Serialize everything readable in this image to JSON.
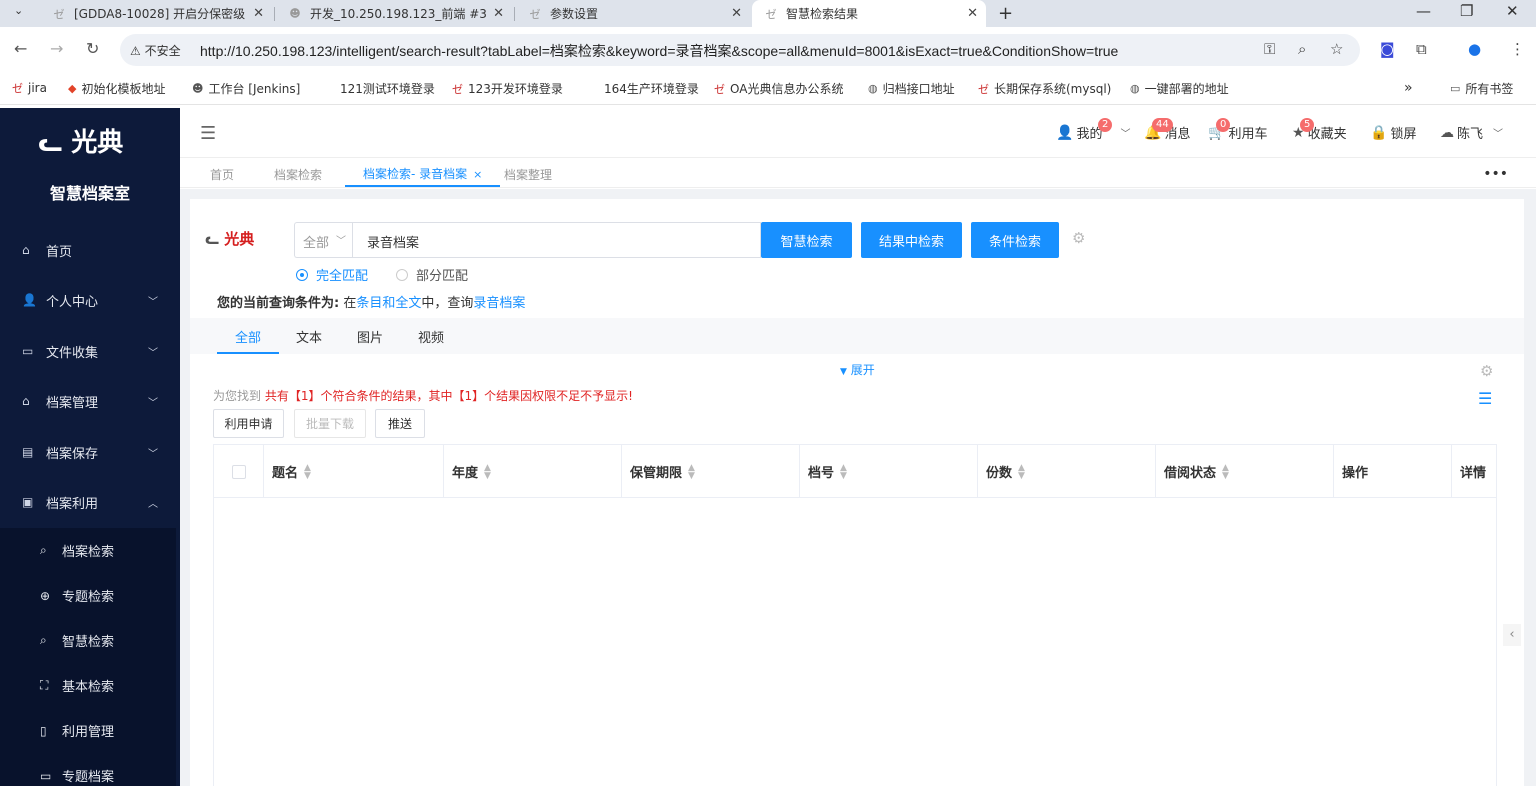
{
  "browser": {
    "tabs": [
      {
        "title": "[GDDA8-10028] 开启分保密级",
        "active": false
      },
      {
        "title": "开发_10.250.198.123_前端 #3",
        "active": false
      },
      {
        "title": "参数设置",
        "active": false
      },
      {
        "title": "智慧检索结果",
        "active": true
      }
    ],
    "security_label": "不安全",
    "url": "http://10.250.198.123/intelligent/search-result?tabLabel=档案检索&keyword=录音档案&scope=all&menuId=8001&isExact=true&ConditionShow=true",
    "bookmarks": [
      "jira",
      "初始化模板地址",
      "工作台 [Jenkins]",
      "121测试环境登录",
      "123开发环境登录",
      "164生产环境登录",
      "OA光典信息办公系统",
      "归档接口地址",
      "长期保存系统(mysql)",
      "一键部署的地址"
    ],
    "all_bookmarks": "所有书签"
  },
  "sidebar": {
    "logo": "光典",
    "subtitle": "智慧档案室",
    "items": [
      {
        "label": "首页",
        "icon": "home-icon"
      },
      {
        "label": "个人中心",
        "icon": "user-icon"
      },
      {
        "label": "文件收集",
        "icon": "folder-icon"
      },
      {
        "label": "档案管理",
        "icon": "bank-icon"
      },
      {
        "label": "档案保存",
        "icon": "storage-icon"
      },
      {
        "label": "档案利用",
        "icon": "clipboard-icon"
      }
    ],
    "subitems": [
      {
        "label": "档案检索",
        "icon": "search-icon"
      },
      {
        "label": "专题检索",
        "icon": "compass-icon"
      },
      {
        "label": "智慧检索",
        "icon": "search-icon"
      },
      {
        "label": "基本检索",
        "icon": "scan-icon"
      },
      {
        "label": "利用管理",
        "icon": "book-icon"
      },
      {
        "label": "专题档案",
        "icon": "folder-icon"
      }
    ]
  },
  "topbar": {
    "mine": "我的",
    "mine_badge": "2",
    "messages": "消息",
    "messages_badge": "44",
    "cart": "利用车",
    "cart_badge": "0",
    "favorites": "收藏夹",
    "favorites_badge": "5",
    "lock": "锁屏",
    "user": "陈飞"
  },
  "pagetabs": [
    "首页",
    "档案检索",
    "档案检索- 录音档案",
    "档案整理"
  ],
  "search": {
    "brand": "光典",
    "scope": "全部",
    "keyword": "录音档案",
    "buttons": [
      "智慧检索",
      "结果中检索",
      "条件检索"
    ],
    "exact": "完全匹配",
    "partial": "部分匹配",
    "cond_prefix": "您的当前查询条件为:",
    "cond_in": "在",
    "cond_scope": "条目和全文",
    "cond_mid": "中，查询",
    "cond_keyword": "录音档案"
  },
  "type_tabs": [
    "全部",
    "文本",
    "图片",
    "视频"
  ],
  "expand": "展开",
  "result": {
    "prefix": "为您找到",
    "text": "共有【1】个符合条件的结果，其中【1】个结果因权限不足不予显示!"
  },
  "actions": [
    "利用申请",
    "批量下载",
    "推送"
  ],
  "table": {
    "columns": [
      "题名",
      "年度",
      "保管期限",
      "档号",
      "份数",
      "借阅状态",
      "操作",
      "详情"
    ]
  }
}
